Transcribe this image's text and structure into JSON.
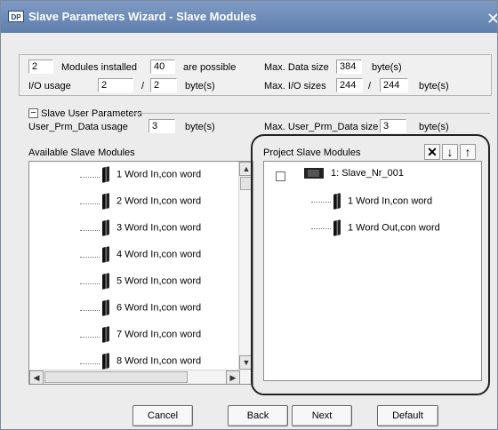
{
  "window": {
    "icon_text": "DP",
    "title": "Slave Parameters Wizard - Slave Modules",
    "close_symbol": "✕"
  },
  "module_summary": {
    "modules_installed_value": "2",
    "modules_installed_label": "Modules installed",
    "possible_value": "40",
    "possible_label": "are possible",
    "max_data_size_label": "Max. Data size",
    "max_data_size_value": "384",
    "max_data_size_unit": "byte(s)",
    "io_usage_label": "I/O usage",
    "io_usage_in": "2",
    "io_usage_separator": "/",
    "io_usage_out": "2",
    "io_usage_unit": "byte(s)",
    "max_io_sizes_label": "Max. I/O sizes",
    "max_io_in": "244",
    "max_io_separator": "/",
    "max_io_out": "244",
    "max_io_unit": "byte(s)"
  },
  "user_parameters": {
    "collapse_symbol": "−",
    "title": "Slave User Parameters",
    "usage_label": "User_Prm_Data usage",
    "usage_value": "3",
    "usage_unit": "byte(s)",
    "max_label": "Max. User_Prm_Data size",
    "max_value": "3",
    "max_unit": "byte(s)"
  },
  "available_modules": {
    "title": "Available Slave Modules",
    "items": [
      "1 Word In,con word",
      "2 Word In,con word",
      "3 Word In,con word",
      "4 Word In,con word",
      "5 Word In,con word",
      "6 Word In,con word",
      "7 Word In,con word",
      "8 Word In,con word"
    ]
  },
  "project_modules": {
    "title": "Project Slave Modules",
    "root": "1: Slave_Nr_001",
    "items": [
      "1 Word In,con word",
      "1 Word Out,con word"
    ],
    "delete_symbol": "✕",
    "move_down_symbol": "↓",
    "move_up_symbol": "↑"
  },
  "buttons": {
    "cancel": "Cancel",
    "back": "Back",
    "next": "Next",
    "default": "Default"
  }
}
